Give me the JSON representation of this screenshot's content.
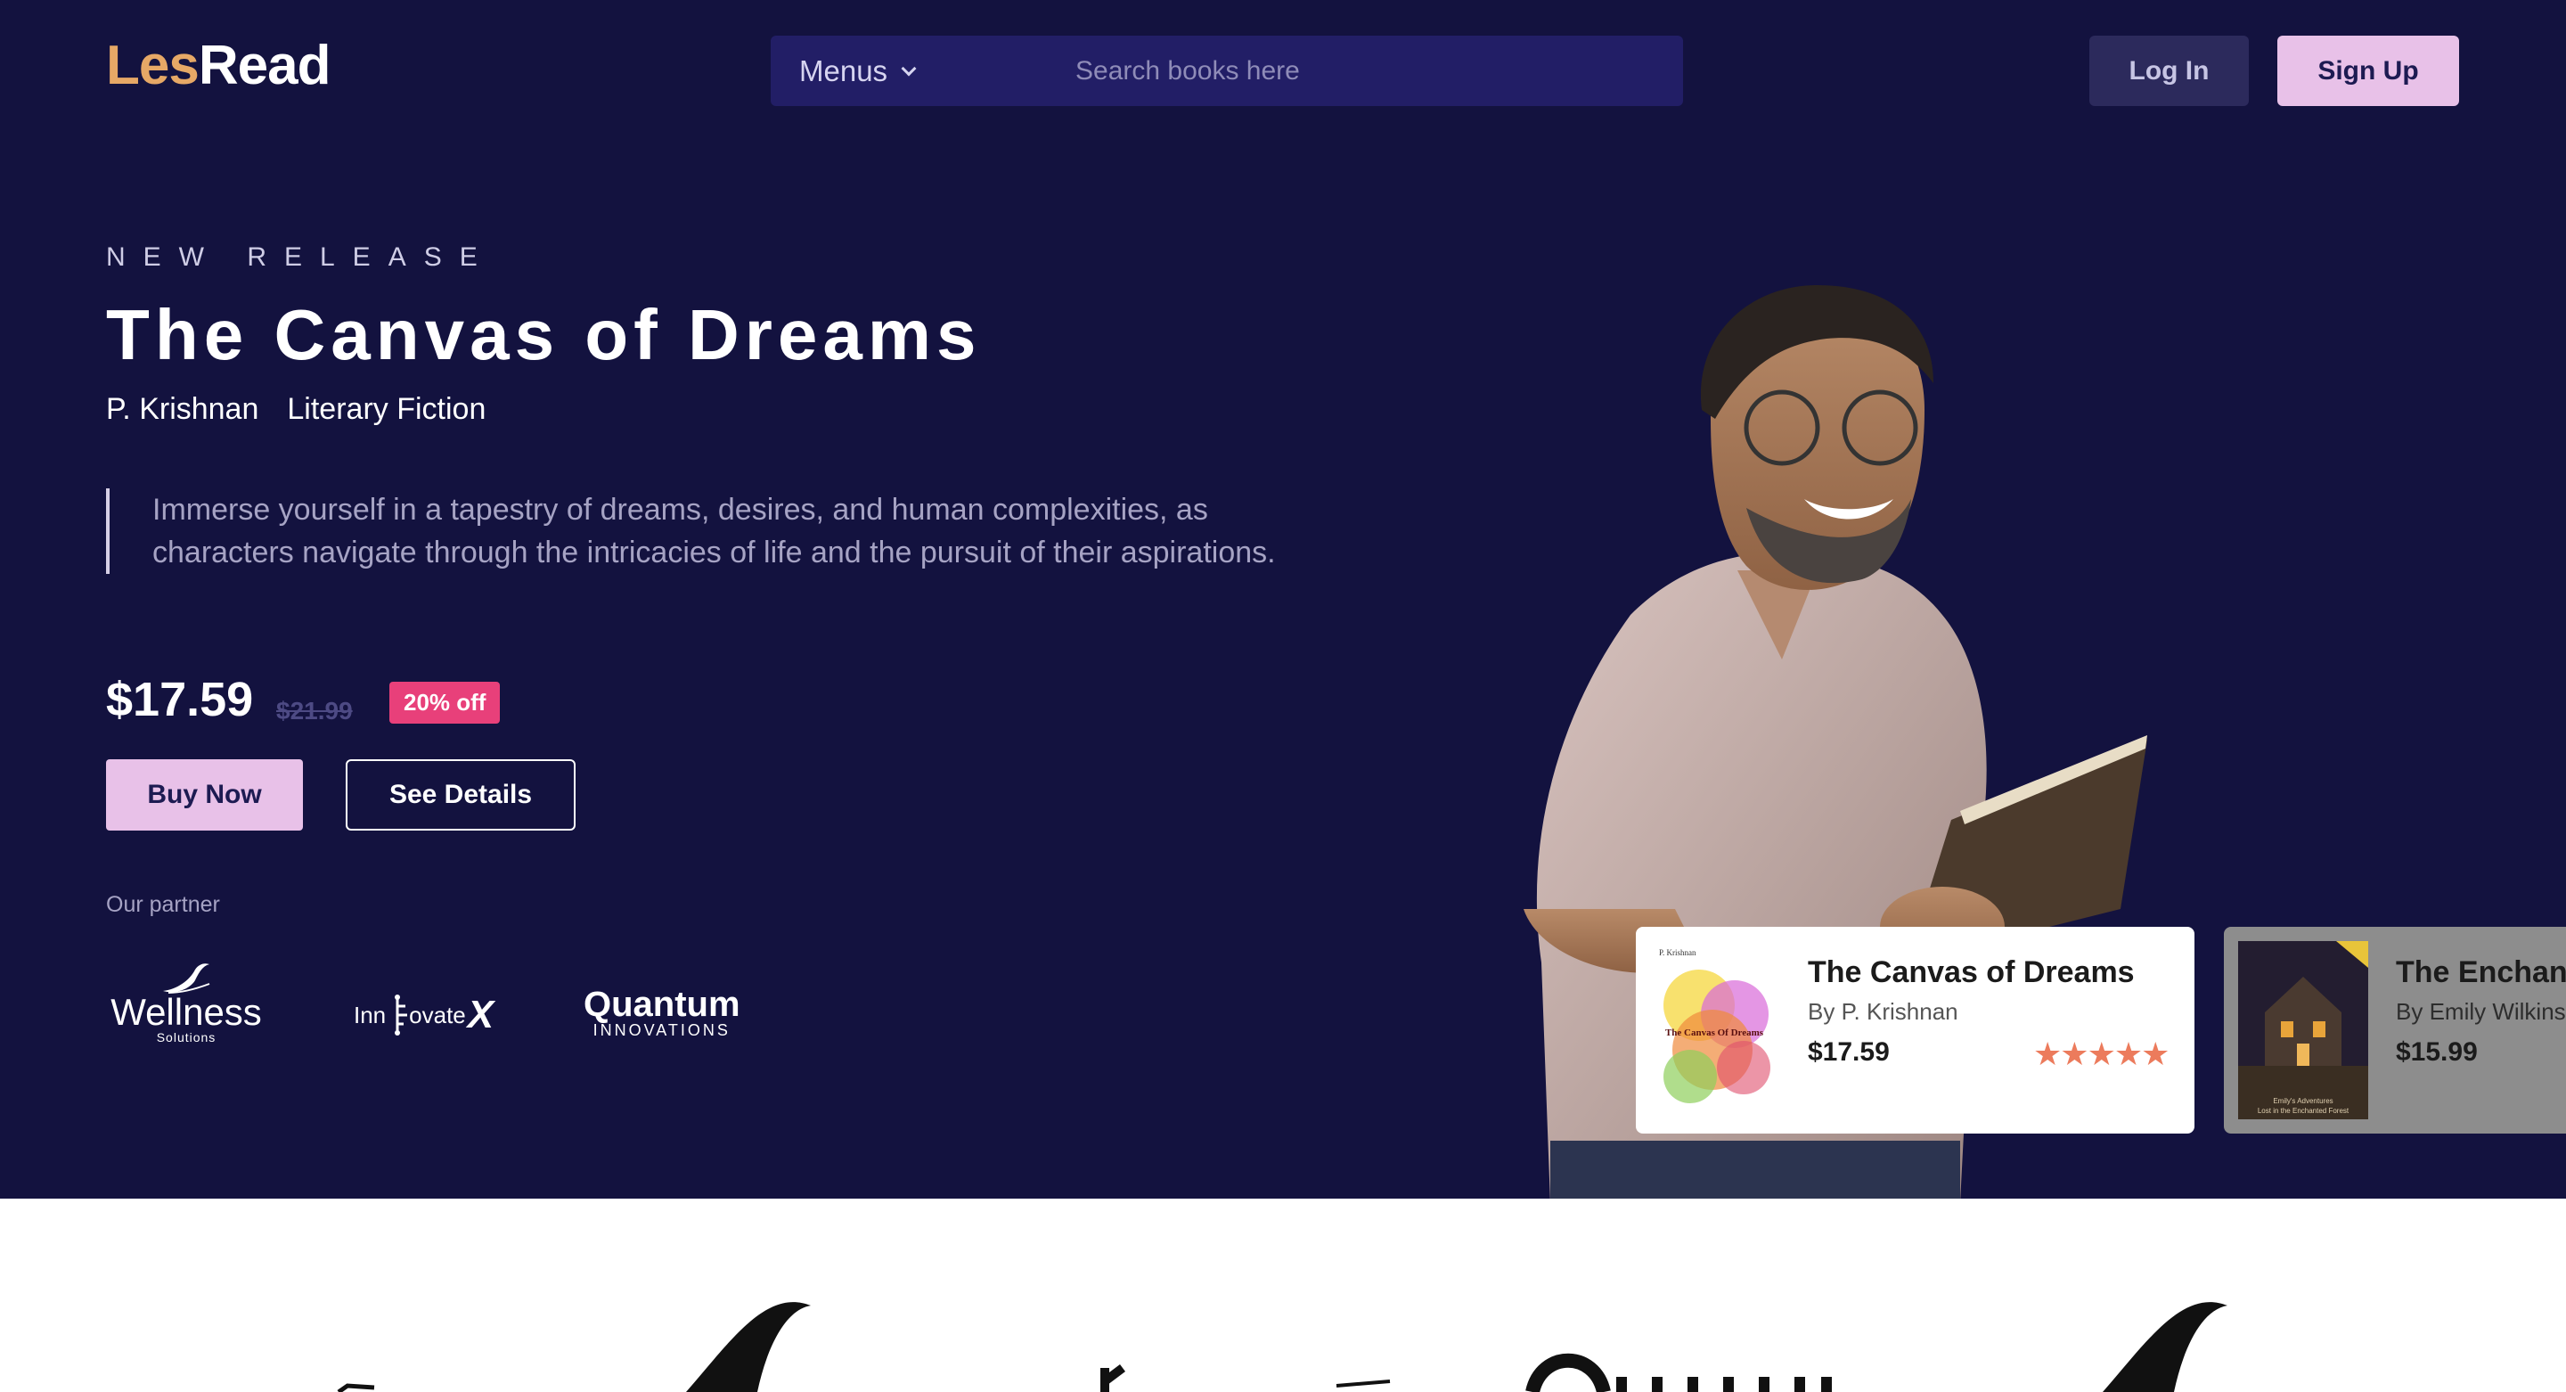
{
  "brand": {
    "part1": "Les",
    "part2": "Read"
  },
  "nav": {
    "menus_label": "Menus",
    "search_placeholder": "Search books here",
    "login": "Log In",
    "signup": "Sign Up"
  },
  "hero": {
    "eyebrow": "NEW RELEASE",
    "title": "The Canvas of Dreams",
    "author": "P. Krishnan",
    "genre": "Literary Fiction",
    "description": "Immerse yourself in a tapestry of dreams, desires, and human complexities, as characters navigate through the intricacies of life and the pursuit of their aspirations.",
    "price": "$17.59",
    "old_price": "$21.99",
    "discount": "20% off",
    "buy": "Buy Now",
    "details": "See Details"
  },
  "partners": {
    "label": "Our partner",
    "wellness": {
      "name": "Wellness",
      "sub": "Solutions"
    },
    "innovatex": {
      "pre": "Inn",
      "mid": "ovate",
      "x": "X"
    },
    "quantum": {
      "name": "Quantum",
      "sub": "INNOVATIONS"
    }
  },
  "cards": [
    {
      "title": "The Canvas of Dreams",
      "author": "By P. Krishnan",
      "price": "$17.59",
      "rating": 5,
      "cover_author": "P. Krishnan",
      "cover_title": "The Canvas Of Dreams"
    },
    {
      "title": "The Enchan",
      "author": "By Emily Wilkins",
      "price": "$15.99",
      "cover_lines": [
        "Emily's Adventures",
        "Lost in the Enchanted Forest"
      ]
    }
  ],
  "colors": {
    "hero_bg": "#13123f",
    "accent_pink": "#e8c1e8",
    "brand_orange": "#e6a866",
    "discount": "#e8407a",
    "star": "#ec7b5c"
  }
}
